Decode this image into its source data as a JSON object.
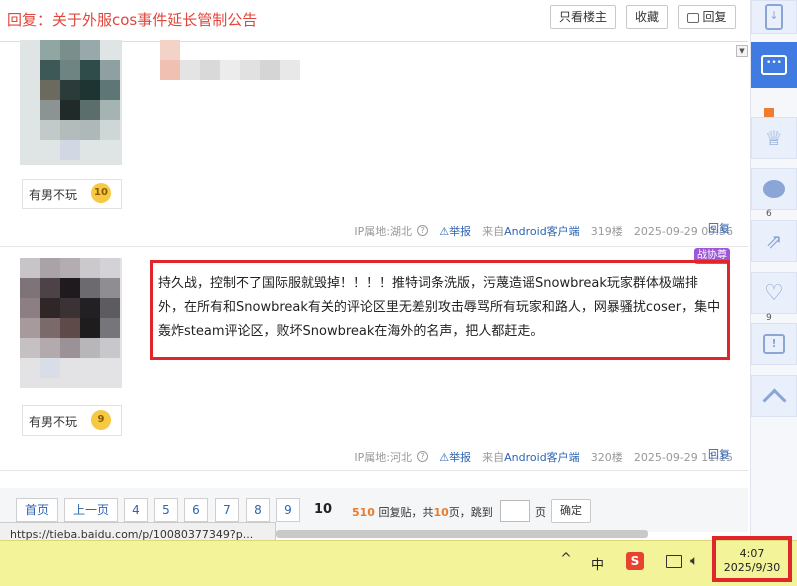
{
  "header": {
    "title": "回复：关于外服cos事件延长管制公告",
    "only_op": "只看楼主",
    "favorite": "收藏",
    "reply": "回复"
  },
  "posts": [
    {
      "username": "有男不玩",
      "level": "10",
      "ip": "IP属地:湖北",
      "report": "举报",
      "source_prefix": "来自",
      "source_link": "Android客户端",
      "floor": "319楼",
      "time": "2025-09-29 09:56",
      "reply": "回复"
    },
    {
      "username": "有男不玩",
      "level": "9",
      "content": "持久战，控制不了国际服就毁掉！！！！推特词条洗版，污蔑造谣Snowbreak玩家群体极端排外，在所有和Snowbreak有关的评论区里无差别攻击辱骂所有玩家和路人，网暴骚扰coser，集中轰炸steam评论区，败坏Snowbreak在海外的名声，把人都赶走。",
      "ip": "IP属地:河北",
      "report": "举报",
      "source_prefix": "来自",
      "source_link": "Android客户端",
      "floor": "320楼",
      "time": "2025-09-29 11:15",
      "reply": "回复",
      "tag": "战协尊"
    }
  ],
  "pagination": {
    "first": "首页",
    "prev": "上一页",
    "pages": [
      "4",
      "5",
      "6",
      "7",
      "8",
      "9"
    ],
    "current": "10",
    "reply_count": "510",
    "reply_text": "回复贴，共",
    "total_pages": "10",
    "pages_suffix": "页，跳到",
    "page_unit": "页",
    "confirm": "确定"
  },
  "status_url": "https://tieba.baidu.com/p/10080377349?p...",
  "taskbar": {
    "time": "4:07",
    "date": "2025/9/30",
    "ime": "中",
    "chevron": "^"
  },
  "rail": {
    "count_a": "6",
    "count_b": "9"
  },
  "colors": {
    "title_red": "#e0463c",
    "link_blue": "#2d64b3",
    "highlight_red": "#e0262b",
    "taskbar": "#f3f39a",
    "rail_blue": "#3f7be0"
  }
}
